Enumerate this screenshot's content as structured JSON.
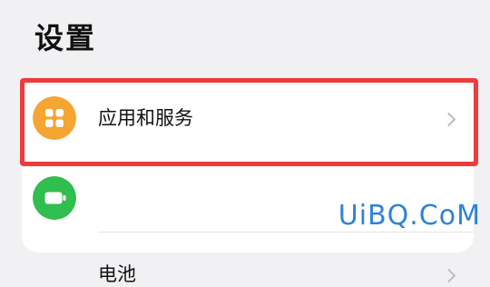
{
  "page": {
    "title": "设置"
  },
  "settings": {
    "items": [
      {
        "label": "应用和服务",
        "icon": "apps-grid-icon",
        "icon_color": "#f4a532"
      },
      {
        "label": "电池",
        "icon": "battery-icon",
        "icon_color": "#2fbe4f"
      }
    ]
  },
  "watermark": "UiBQ.CoM",
  "colors": {
    "background": "#f1f1f3",
    "highlight": "#ef3b3b",
    "chevron": "#bdbdbd",
    "watermark": "#2f82d8"
  }
}
